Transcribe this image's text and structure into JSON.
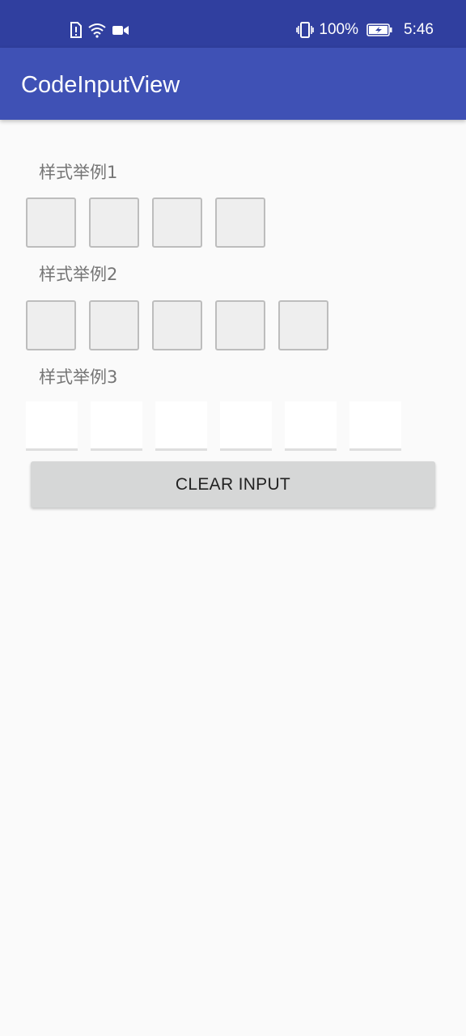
{
  "status_bar": {
    "battery_percent": "100%",
    "time": "5:46",
    "left_icons": [
      "alert-icon",
      "wifi-icon",
      "video-icon"
    ],
    "right_icons": [
      "vibrate-icon",
      "battery-icon"
    ]
  },
  "app_bar": {
    "title": "CodeInputView",
    "color": "#3f51b5",
    "status_color": "#303f9f"
  },
  "sections": [
    {
      "label": "样式举例1",
      "box_count": 4,
      "style": "bordered"
    },
    {
      "label": "样式举例2",
      "box_count": 5,
      "style": "bordered"
    },
    {
      "label": "样式举例3",
      "box_count": 6,
      "style": "underline"
    }
  ],
  "clear_button": {
    "label": "CLEAR INPUT"
  }
}
